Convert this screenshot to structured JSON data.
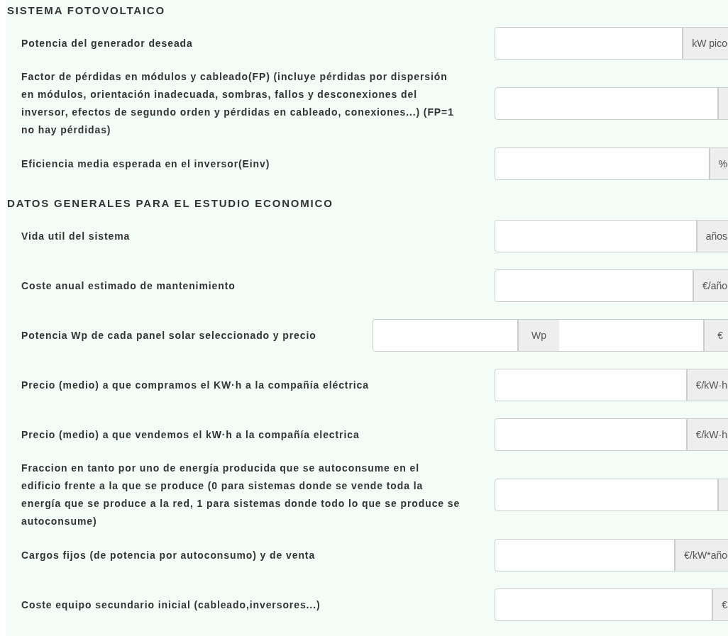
{
  "sections": [
    {
      "title": "SISTEMA FOTOVOLTAICO",
      "fields": [
        {
          "label": "Potencia del generador deseada",
          "units": [
            "kW pico"
          ]
        },
        {
          "label": "Factor de pérdidas en módulos y cableado(FP) (incluye pérdidas por dispersión en módulos, orientación inadecuada, sombras, fallos y desconexiones del inversor, efectos de segundo orden y pérdidas en cableado, conexiones...) (FP=1 no hay pérdidas)"
        },
        {
          "label": "Eficiencia media esperada en el inversor(Einv)",
          "units": [
            "%"
          ]
        }
      ]
    },
    {
      "title": "DATOS GENERALES PARA EL ESTUDIO ECONOMICO",
      "fields": [
        {
          "label": "Vida util del sistema",
          "units": [
            "años"
          ]
        },
        {
          "label": "Coste anual estimado de mantenimiento",
          "units": [
            "€/año"
          ]
        },
        {
          "label": "Potencia Wp de cada panel solar seleccionado y precio",
          "units": [
            "Wp",
            "€"
          ]
        },
        {
          "label": "Precio (medio) a que compramos el KW·h a la compañía eléctrica",
          "units": [
            "€/kW·h"
          ]
        },
        {
          "label": "Precio (medio) a que vendemos el kW·h a la compañía electrica",
          "units": [
            "€/kW·h"
          ]
        },
        {
          "label": "Fraccion en tanto por uno de energía producida que se autoconsume en el edificio frente a la que se produce (0 para sistemas donde se vende toda la energía que se produce a la red, 1 para sistemas donde todo lo que se produce se autoconsume)"
        },
        {
          "label": "Cargos fijos (de potencia por autoconsumo) y de venta",
          "units": [
            "€/kW*año"
          ]
        },
        {
          "label": "Coste equipo secundario inicial (cableado,inversores...)",
          "units": [
            "€"
          ]
        }
      ]
    }
  ]
}
